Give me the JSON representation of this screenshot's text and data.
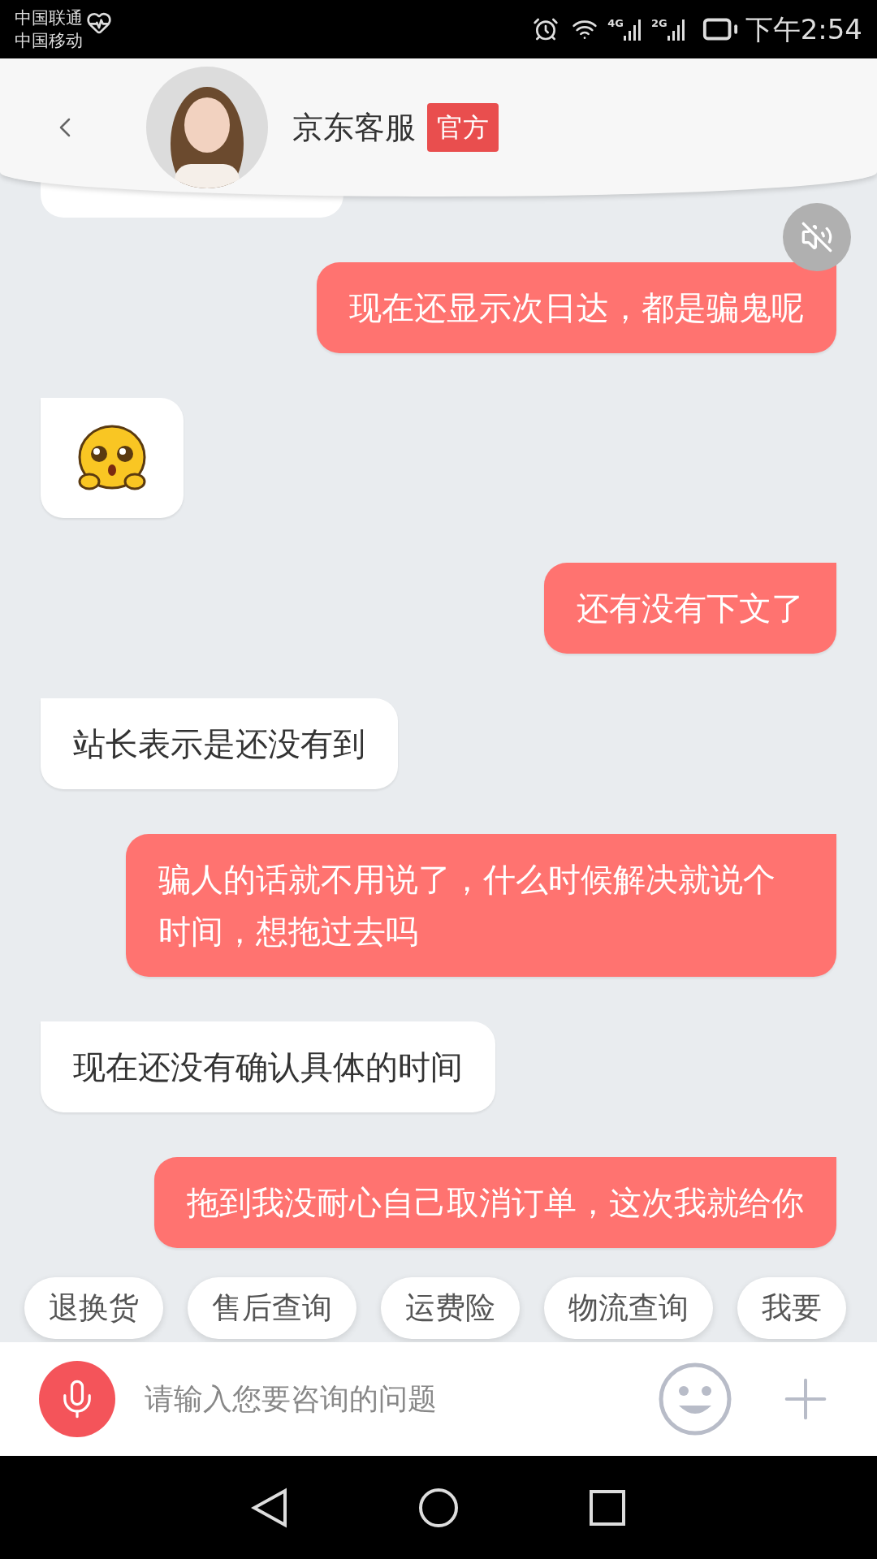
{
  "status_bar": {
    "carriers": [
      "中国联通",
      "中国移动"
    ],
    "networks": [
      "4G",
      "2G"
    ],
    "time": "下午2:54"
  },
  "header": {
    "title": "京东客服",
    "badge": "官方"
  },
  "messages": [
    {
      "kind": "cut_off",
      "outgoing": false
    },
    {
      "kind": "text",
      "outgoing": true,
      "text": "现在还显示次日达，都是骗鬼呢"
    },
    {
      "kind": "sticker",
      "outgoing": false
    },
    {
      "kind": "text",
      "outgoing": true,
      "text": "还有没有下文了"
    },
    {
      "kind": "text",
      "outgoing": false,
      "text": "站长表示是还没有到"
    },
    {
      "kind": "text",
      "outgoing": true,
      "text": "骗人的话就不用说了，什么时候解决就说个时间，想拖过去吗"
    },
    {
      "kind": "text",
      "outgoing": false,
      "text": "现在还没有确认具体的时间"
    },
    {
      "kind": "text",
      "outgoing": true,
      "text": "拖到我没耐心自己取消订单，这次我就给你"
    }
  ],
  "quick_replies": [
    "退换货",
    "售后查询",
    "运费险",
    "物流查询",
    "我要"
  ],
  "input": {
    "placeholder": "请输入您要咨询的问题"
  }
}
